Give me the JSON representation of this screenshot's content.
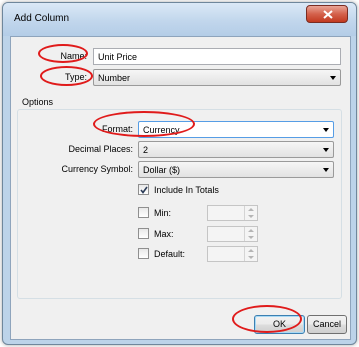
{
  "window": {
    "title": "Add Column",
    "close_label": "close"
  },
  "fields": {
    "name_label": "Name:",
    "name_value": "Unit Price",
    "type_label": "Type:",
    "type_value": "Number"
  },
  "options": {
    "group_label": "Options",
    "format_label": "Format:",
    "format_value": "Currency",
    "decimal_label": "Decimal Places:",
    "decimal_value": "2",
    "currency_label": "Currency Symbol:",
    "currency_value": "Dollar ($)",
    "include_totals_label": "Include In Totals",
    "include_totals_checked": true,
    "min_label": "Min:",
    "max_label": "Max:",
    "default_label": "Default:"
  },
  "buttons": {
    "ok_label": "OK",
    "cancel_label": "Cancel"
  },
  "colors": {
    "highlight_ring": "#e01b1b",
    "title_bar": "#c1d6ec",
    "dialog_bg": "#f0f0f0"
  }
}
